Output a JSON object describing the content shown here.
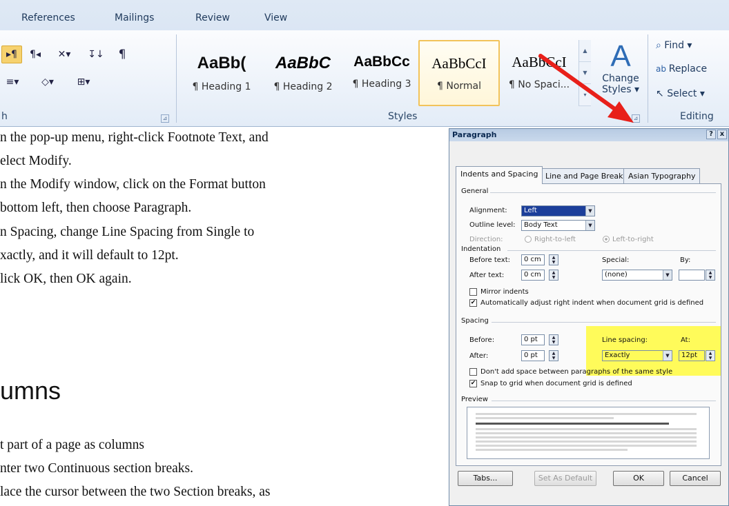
{
  "ribbon": {
    "tabs": [
      "References",
      "Mailings",
      "Review",
      "View"
    ],
    "groups": {
      "paragraph": "h",
      "styles": "Styles",
      "editing": "Editing"
    },
    "styles": [
      {
        "preview": "AaBb(",
        "name": "¶ Heading 1"
      },
      {
        "preview": "AaBbC",
        "name": "¶ Heading 2"
      },
      {
        "preview": "AaBbCc",
        "name": "¶ Heading 3"
      },
      {
        "preview": "AaBbCcI",
        "name": "¶ Normal"
      },
      {
        "preview": "AaBbCcI",
        "name": "¶ No Spaci..."
      }
    ],
    "change_styles": {
      "line1": "Change",
      "line2": "Styles ▾"
    },
    "editing": {
      "find": "Find ▾",
      "replace": "Replace",
      "select": "Select ▾"
    }
  },
  "document": {
    "lines": [
      "n the pop-up menu, right-click Footnote Text, and",
      "elect Modify.",
      "n the Modify window, click on the Format button",
      " bottom left, then choose Paragraph.",
      "n Spacing, change Line Spacing from Single to",
      "xactly, and it will default to 12pt.",
      "lick OK, then OK again."
    ],
    "heading": "umns",
    "lines2": [
      "t part of a page as columns",
      "nter two Continuous section breaks.",
      "lace the cursor between the two Section breaks, as"
    ]
  },
  "dialog": {
    "title": "Paragraph",
    "help": "?",
    "close": "x",
    "tabs": [
      "Indents and Spacing",
      "Line and Page Breaks",
      "Asian Typography"
    ],
    "general": {
      "section": "General",
      "alignment_label": "Alignment:",
      "alignment_value": "Left",
      "outline_label": "Outline level:",
      "outline_value": "Body Text",
      "direction_label": "Direction:",
      "rtl": "Right-to-left",
      "ltr": "Left-to-right"
    },
    "indentation": {
      "section": "Indentation",
      "before_label": "Before text:",
      "before_value": "0 cm",
      "after_label": "After text:",
      "after_value": "0 cm",
      "special_label": "Special:",
      "special_value": "(none)",
      "by_label": "By:",
      "mirror": "Mirror indents",
      "auto_adjust": "Automatically adjust right indent when document grid is defined"
    },
    "spacing": {
      "section": "Spacing",
      "before_label": "Before:",
      "before_value": "0 pt",
      "after_label": "After:",
      "after_value": "0 pt",
      "line_spacing_label": "Line spacing:",
      "line_spacing_value": "Exactly",
      "at_label": "At:",
      "at_value": "12pt",
      "dont_add": "Don't add space between paragraphs of the same style",
      "snap": "Snap to grid when document grid is defined"
    },
    "preview": {
      "section": "Preview"
    },
    "buttons": {
      "tabs": "Tabs...",
      "default": "Set As Default",
      "ok": "OK",
      "cancel": "Cancel"
    }
  },
  "colors": {
    "arrow": "#e8201a",
    "highlight": "#fffb5a",
    "ribbon_text": "#1e395b"
  }
}
